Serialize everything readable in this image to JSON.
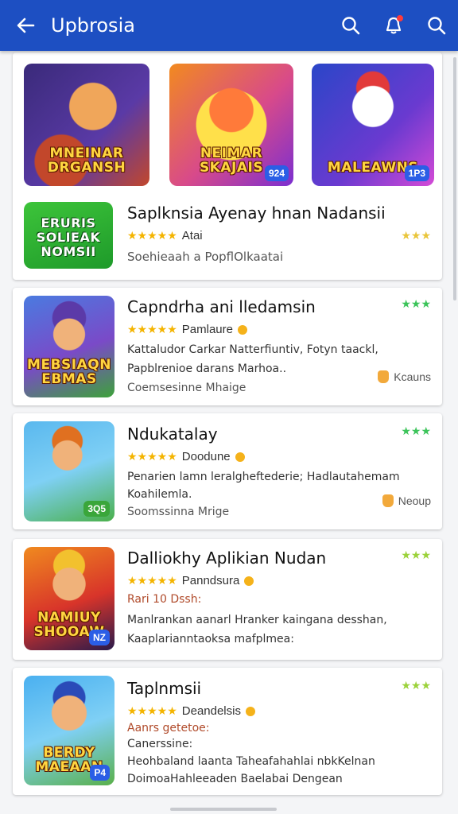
{
  "appbar": {
    "title": "Upbrosia",
    "back_icon": "arrow-left-icon",
    "actions": [
      "search-icon",
      "bell-icon",
      "search-icon"
    ]
  },
  "featured": [
    {
      "caption": "MNEINAR DRGANSH",
      "badge": "",
      "colors": [
        "#3a2a7a",
        "#c2472b"
      ]
    },
    {
      "caption": "NEIMAR SKAJAIS",
      "badge": "924",
      "colors": [
        "#f28a1f",
        "#7b2fd0"
      ]
    },
    {
      "caption": "MALEAWNS",
      "badge": "1P3",
      "colors": [
        "#2a46c8",
        "#d44ad6"
      ]
    }
  ],
  "top_app": {
    "icon_caption": "ERURIS SOLIEAK NOMSII",
    "name": "Saplknsia Ayenay hnan Nadansii",
    "rating": "★★★★★",
    "rating_text": "Atai",
    "subtitle": "Soehieaah a PopflOlkaatai",
    "mini_stars": "★★★"
  },
  "apps": [
    {
      "name": "Capndrha ani lledamsin",
      "rating": "★★★★★",
      "rating_text": "Pamlaure",
      "lines": [
        "Kattaludor Carkar Natterfiuntiv, Fotyn taackl,",
        "Papblrenioe darans Marhoa..",
        "Coemsesinne Mhaige"
      ],
      "mini_stars": "★★★",
      "side_label": "Kcauns",
      "icon_caption": "MEBSIAQN EBMAS",
      "badge": ""
    },
    {
      "name": "Ndukatalay",
      "rating": "★★★★★",
      "rating_text": "Doodune",
      "lines": [
        "Penarien lamn leralgheftederie; Hadlautahemam",
        "Koahilemla.",
        "Soomssinna Mrige"
      ],
      "mini_stars": "★★★",
      "side_label": "Neoup",
      "icon_caption": "",
      "badge": "3Q5"
    },
    {
      "name": "Dalliokhy Aplikian Nudan",
      "rating": "★★★★★",
      "rating_text": "Panndsura",
      "lines": [
        "Rari 10 Dssh:",
        "Manlrankan aanarl Hranker kaingana desshan,",
        "Kaaplarianntaoksa mafplmea:"
      ],
      "mini_stars": "★★★",
      "side_label": "",
      "icon_caption": "NAMIUY SHOOAW",
      "badge": "NZ"
    },
    {
      "name": "Taplnmsii",
      "rating": "★★★★★",
      "rating_text": "Deandelsis",
      "lines": [
        "Aanrs getetoe:",
        "Canerssine:",
        "Heohbaland laanta Taheafahahlai nbkKelnan",
        "DoimoaHahleeaden Baelabai Dengean"
      ],
      "mini_stars": "★★★",
      "side_label": "",
      "icon_caption": "BERDY MAEAAN",
      "badge": "P4"
    }
  ],
  "colors": {
    "appbar": "#1d4fc2",
    "star": "#f4b400",
    "mini_star_green": "#3cc45a"
  }
}
